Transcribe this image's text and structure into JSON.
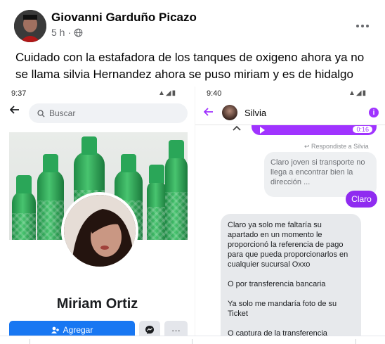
{
  "post": {
    "author": "Giovanni Garduño Picazo",
    "time": "5 h",
    "separator": "·",
    "text": "Cuidado con la estafadora de los tanques de oxigeno  ahora ya no se llama silvia Hernandez  ahora se puso miriam y es de hidalgo",
    "icons": {
      "privacy": "globe-icon",
      "more": "more-dots-icon"
    }
  },
  "left_screenshot": {
    "status_time": "9:37",
    "status_icons": "⚙ ✉ ••",
    "search_placeholder": "Buscar",
    "profile_name": "Miriam Ortiz",
    "add_button": "Agregar",
    "more_button": "···",
    "colors": {
      "primary": "#1877f2",
      "tank_green": "#2aa658"
    }
  },
  "right_screenshot": {
    "status_time": "9:40",
    "status_icons": "⚙ ✉ ••",
    "contact_name": "Silvia",
    "audio_time": "0:16",
    "reply_note": "Respondiste a Silvia",
    "quoted_message": "Claro joven si transporte no llega a encontrar bien la dirección ...",
    "sent_message": "Claro",
    "incoming_messages": [
      "Claro ya solo me faltaría su apartado en un momento le proporcionó la referencia de pago para que pueda proporcionarlos en cualquier sucursal Oxxo",
      "O por transferencia bancaria",
      "Ya solo me mandaría foto de su Ticket",
      "O captura de la transferencia"
    ],
    "colors": {
      "accent": "#a033ff"
    }
  }
}
